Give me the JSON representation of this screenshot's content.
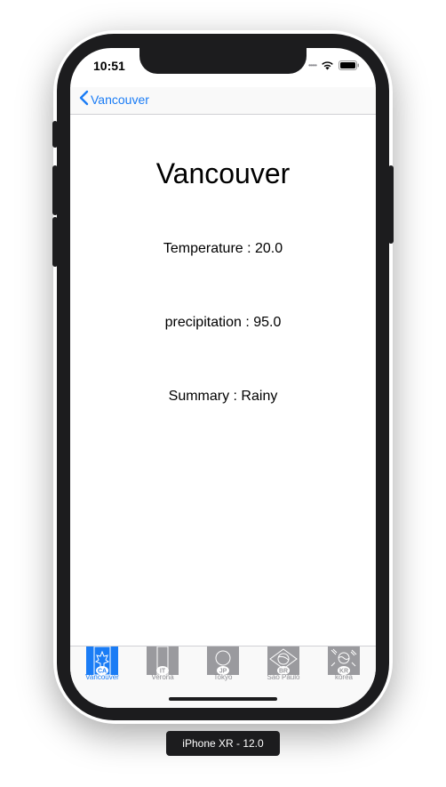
{
  "status_bar": {
    "time": "10:51",
    "signal_icon": "signal-dots-icon",
    "wifi_icon": "wifi-icon",
    "battery_icon": "battery-icon"
  },
  "nav": {
    "back_label": "Vancouver",
    "back_icon": "chevron-left-icon",
    "accent_color": "#1a7cf5"
  },
  "main": {
    "city_title": "Vancouver",
    "temperature": "Temperature : 20.0",
    "precipitation": "precipitation : 95.0",
    "summary": "Summary : Rainy"
  },
  "tabs": [
    {
      "label": "Vancouver",
      "badge": "CA",
      "icon": "canada-flag-icon",
      "active": true
    },
    {
      "label": "Verona",
      "badge": "IT",
      "icon": "italy-flag-icon",
      "active": false
    },
    {
      "label": "Tokyo",
      "badge": "JP",
      "icon": "japan-flag-icon",
      "active": false
    },
    {
      "label": "Sao Paulo",
      "badge": "BR",
      "icon": "brazil-flag-icon",
      "active": false
    },
    {
      "label": "korea",
      "badge": "KR",
      "icon": "korea-flag-icon",
      "active": false
    }
  ],
  "device_label": "iPhone XR - 12.0"
}
